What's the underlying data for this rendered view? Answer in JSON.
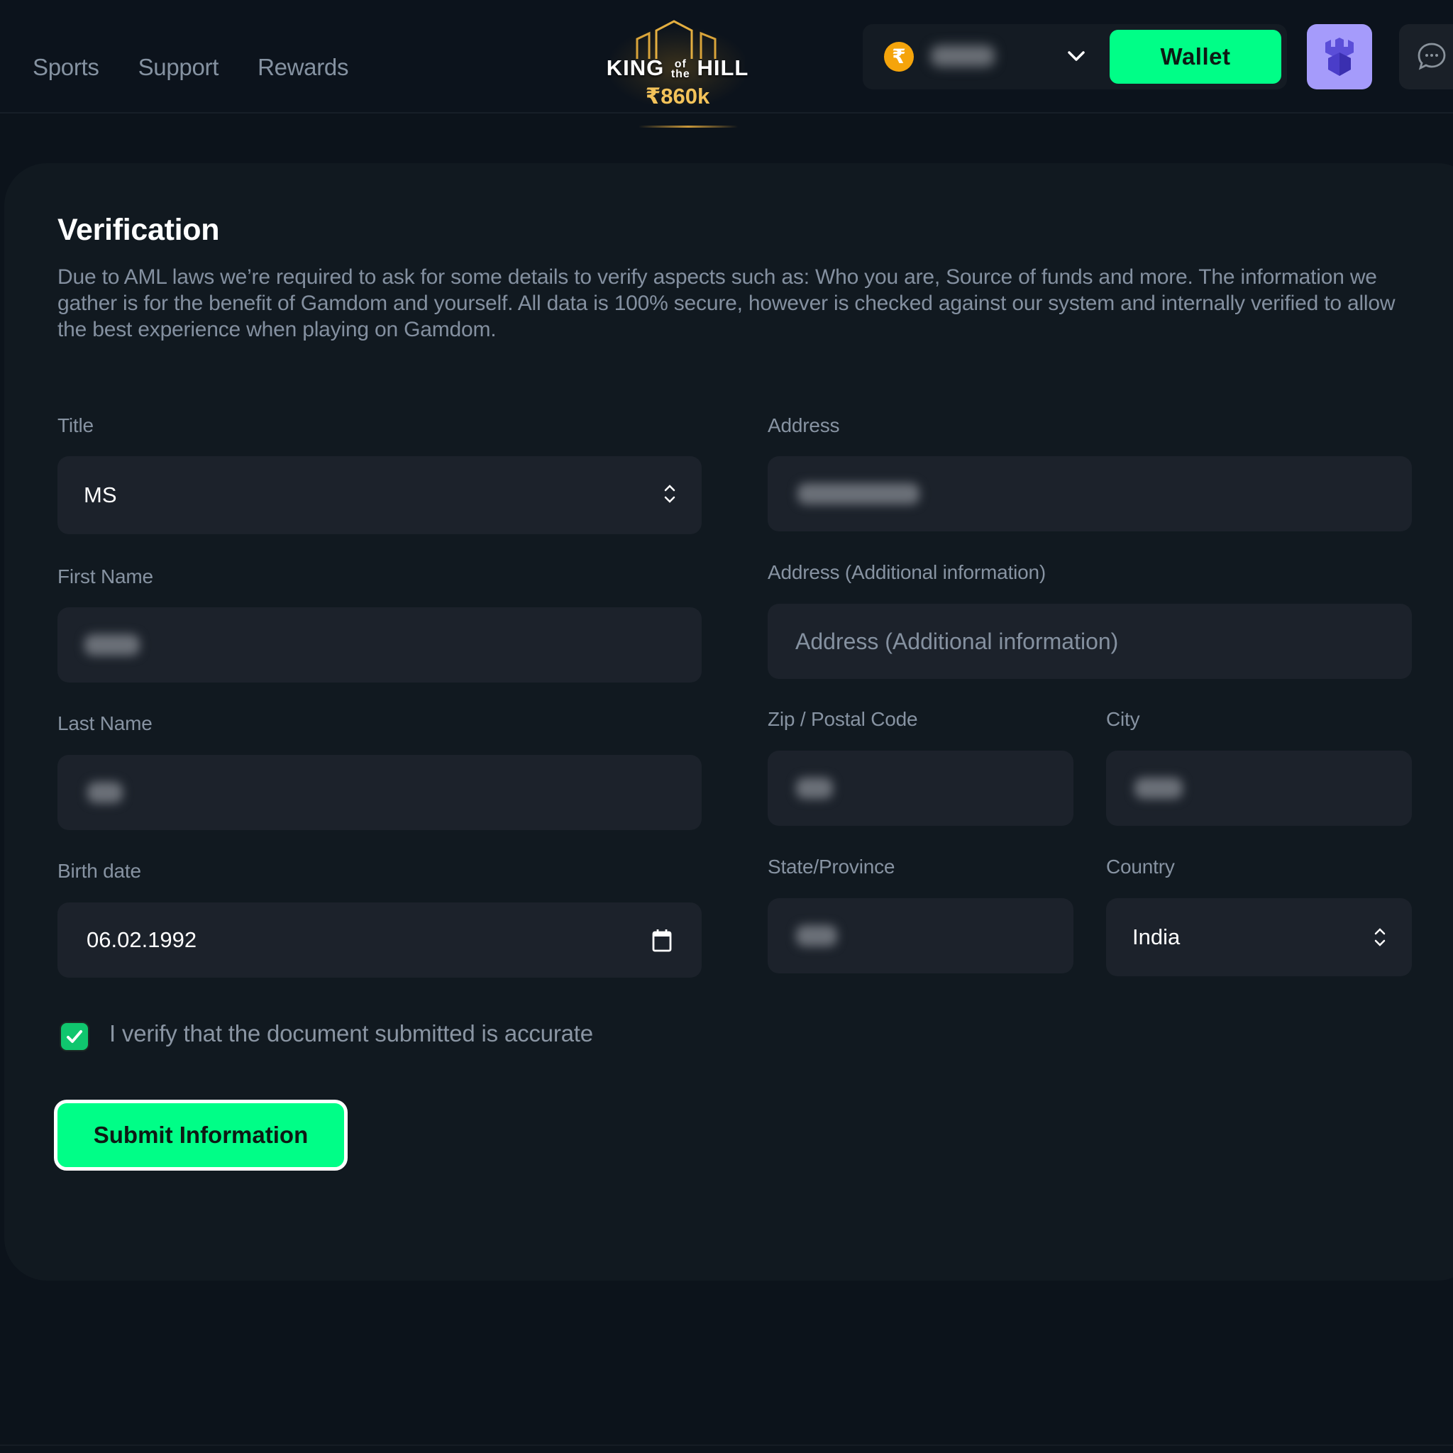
{
  "header": {
    "nav": [
      {
        "label": "Sports"
      },
      {
        "label": "Support"
      },
      {
        "label": "Rewards"
      }
    ],
    "promo": {
      "title_left": "KING",
      "title_of": "of",
      "title_the": "the",
      "title_right": "HILL",
      "amount": "₹860k"
    },
    "balance": {
      "currency_symbol": "₹",
      "currency_icon": "rupee-coin-icon",
      "value_obscured": true
    },
    "wallet_label": "Wallet",
    "avatar_icon": "castle-shield-icon",
    "chat_icon": "chat-bubble-icon"
  },
  "page": {
    "title": "Verification",
    "intro": "Due to AML laws we’re required to ask for some details to verify aspects such as: Who you are, Source of funds and more. The information we gather is for the benefit of Gamdom and yourself. All data is 100% secure, however is checked against our system and internally verified to allow the best experience when playing on Gamdom."
  },
  "form": {
    "title": {
      "label": "Title",
      "value": "MS"
    },
    "first_name": {
      "label": "First Name",
      "value_obscured": true
    },
    "last_name": {
      "label": "Last Name",
      "value_obscured": true
    },
    "birth_date": {
      "label": "Birth date",
      "value": "06.02.1992"
    },
    "address": {
      "label": "Address",
      "value_obscured": true
    },
    "address_additional": {
      "label": "Address (Additional information)",
      "placeholder": "Address (Additional information)"
    },
    "zip": {
      "label": "Zip / Postal Code",
      "value_obscured": true
    },
    "city": {
      "label": "City",
      "value_obscured": true
    },
    "state": {
      "label": "State/Province",
      "value_obscured": true
    },
    "country": {
      "label": "Country",
      "value": "India"
    },
    "verify_checkbox": {
      "label": "I verify that the document submitted is accurate",
      "checked": true
    },
    "submit_label": "Submit Information"
  },
  "colors": {
    "accent": "#00fe87",
    "promo_gold": "#f4c35a",
    "avatar_bg": "#a59bfb",
    "coin": "#f5a40b",
    "background": "#0c131b",
    "card": "#111920",
    "field": "#1c222b"
  }
}
